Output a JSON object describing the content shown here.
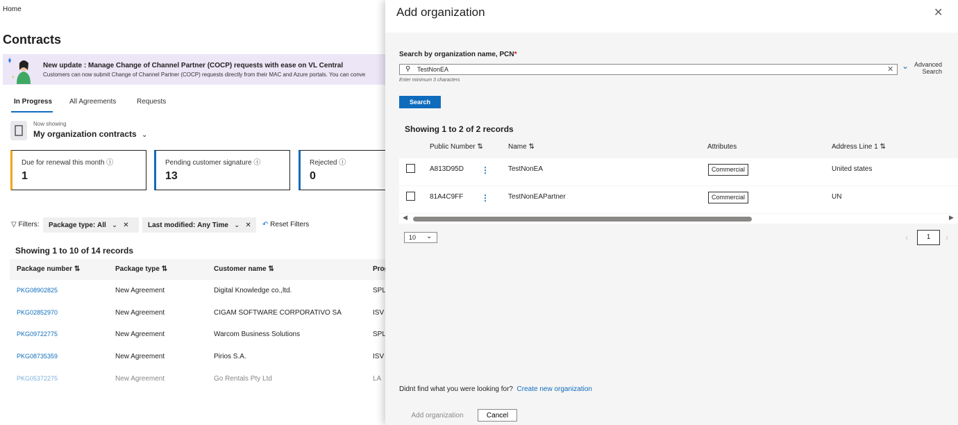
{
  "background": {
    "breadcrumb": "Home",
    "title": "Contracts",
    "banner": {
      "title": "New update : Manage Change of Channel Partner (COCP) requests with ease on VL Central",
      "text": "Customers can now submit Change of Channel Partner (COCP) requests directly from their MAC and Azure portals. You can conve"
    },
    "tabs": [
      "In Progress",
      "All Agreements",
      "Requests"
    ],
    "now_showing_label": "Now showing",
    "now_showing_value": "My organization contracts",
    "cards": [
      {
        "label": "Due for renewal this month",
        "value": "1",
        "accent": "#f7a21b"
      },
      {
        "label": "Pending customer signature",
        "value": "13",
        "accent": "#0f6cbd"
      },
      {
        "label": "Rejected",
        "value": "0",
        "accent": "#0f6cbd"
      }
    ],
    "filters": {
      "label": "Filters:",
      "package_type_label": "Package type:",
      "package_type_value": "All",
      "last_modified_label": "Last modified:",
      "last_modified_value": "Any Time",
      "reset": "Reset Filters"
    },
    "showing": "Showing 1 to 10 of 14 records",
    "table": {
      "headers": [
        "Package number",
        "Package type",
        "Customer name",
        "Prog"
      ],
      "rows": [
        [
          "PKG08902825",
          "New Agreement",
          "Digital Knowledge co.,ltd.",
          "SPLA"
        ],
        [
          "PKG02852970",
          "New Agreement",
          "CIGAM SOFTWARE CORPORATIVO SA",
          "ISV"
        ],
        [
          "PKG09722775",
          "New Agreement",
          "Warcom Business Solutions",
          "SPLA"
        ],
        [
          "PKG08735359",
          "New Agreement",
          "Pirios S.A.",
          "ISV"
        ],
        [
          "PKG05372275",
          "New Agreement",
          "Go Rentals Pty Ltd",
          "LA"
        ]
      ]
    }
  },
  "modal": {
    "title": "Add organization",
    "search_label": "Search by organization name, PCN",
    "required_mark": "*",
    "search_value": "TestNonEA",
    "hint": "Enter minimum 3 characters",
    "advanced_line1": "Advanced",
    "advanced_line2": "Search",
    "search_button": "Search",
    "showing": "Showing 1 to 2 of 2 records",
    "headers": [
      "Public Number",
      "Name",
      "Attributes",
      "Address Line 1"
    ],
    "rows": [
      {
        "public_number": "A813D95D",
        "name": "TestNonEA",
        "attribute": "Commercial",
        "address": "United states"
      },
      {
        "public_number": "81A4C9FF",
        "name": "TestNonEAPartner",
        "attribute": "Commercial",
        "address": "UN"
      }
    ],
    "page_size": "10",
    "page": "1",
    "not_found": "Didnt find what you were looking for?",
    "create_link": "Create new organization",
    "add_button": "Add organization",
    "cancel_button": "Cancel"
  }
}
